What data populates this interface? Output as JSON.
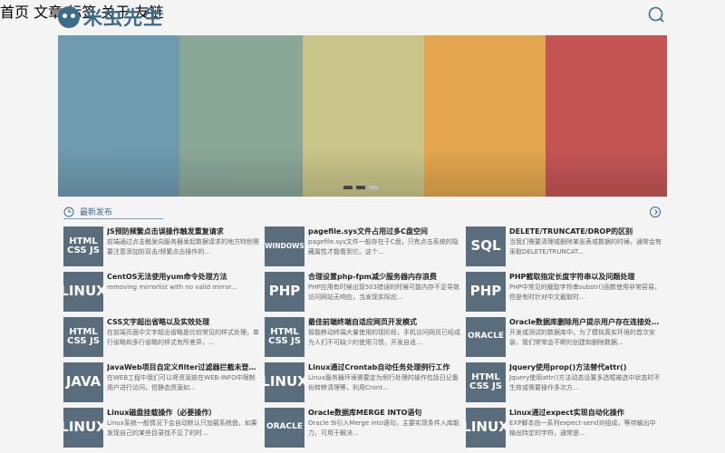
{
  "site": {
    "logo_text": "米虫先生"
  },
  "nav": [
    "首页",
    "文章",
    "标签",
    "关于",
    "友链"
  ],
  "banner": {
    "colors": [
      "#6f9bb0",
      "#8aa798",
      "#c9c58a",
      "#e3a64e",
      "#c45454"
    ],
    "active_dot": 2
  },
  "section": {
    "title": "最新发布"
  },
  "posts": [
    {
      "thumb": [
        "HTML",
        "CSS JS"
      ],
      "title": "JS预防频繁点击误操作触发重复请求",
      "desc": "前端通过点击触发向服务器发起数据请求的地方特别需要注意添加防双击/频繁点击操作的..."
    },
    {
      "thumb": [
        "WINDOWS"
      ],
      "title": "pagefile.sys文件占用过多C盘空间",
      "desc": "pagefile.sys文件一般存在于C盘，只有点击系统的隐藏属性才能看到它。这个..."
    },
    {
      "thumb": [
        "SQL"
      ],
      "title": "DELETE/TRUNCATE/DROP的区别",
      "desc": "当我们需要清理或删除某张表或数据的时候，通常会有采取DELETE/TRUNCAT..."
    },
    {
      "thumb": [
        "LINUX"
      ],
      "title": "CentOS无法使用yum命令处理方法",
      "desc": "removing mirrorlist with no valid mirror..."
    },
    {
      "thumb": [
        "PHP"
      ],
      "title": "合理设置php-fpm减少服务器内存浪费",
      "desc": "PHP应用有时候出现503错误的时候可能内存不足导致访问网站无响应，当发现实际应..."
    },
    {
      "thumb": [
        "PHP"
      ],
      "title": "PHP截取指定长度字符串以及问题处理",
      "desc": "PHP中常见的截取字符串substr()函数使用非常容易，但是有时针对中文截取时..."
    },
    {
      "thumb": [
        "HTML",
        "CSS JS"
      ],
      "title": "CSS文字超出省略以及实效处理",
      "desc": "在前端页面中文字超出省略是比较常见的样式处理，单行省略和多行省略的样式有所差异，..."
    },
    {
      "thumb": [
        "HTML",
        "CSS JS"
      ],
      "title": "最佳前端终端自适应网页开发模式",
      "desc": "智能移动终端大量使用的现阶段，手机访问网页已经成为人们不可缺少的使用习惯，开发自适..."
    },
    {
      "thumb": [
        "ORACLE"
      ],
      "title": "Oracle数据库删除用户提示用户存在连接处理...",
      "desc": "开发或测试的数据库中，为了模拟真实环境的首次安装，我们常常会不断的创建和删除数据..."
    },
    {
      "thumb": [
        "JAVA"
      ],
      "title": "JavaWeb项目自定义filter过滤器拦截未登录...",
      "desc": "在WEB工程中我们可以将资源放在WEB-INFO中限制用户进行访问，但静态资源如..."
    },
    {
      "thumb": [
        "LINUX"
      ],
      "title": "Linux通过Crontab自动任务处理例行工作",
      "desc": "Linux服务器环境需要定为例行处理的操作包括日记备份转移清理等，利用Cront..."
    },
    {
      "thumb": [
        "HTML",
        "CSS JS"
      ],
      "title": "Jquery使用prop()方法替代attr()",
      "desc": "Jquery使用attr()方法动态设置多选框被选中状态时不生效或需要操作多次方..."
    },
    {
      "thumb": [
        "LINUX"
      ],
      "title": "Linux磁盘挂载操作（必要操作）",
      "desc": "Linux系统一般情况下会自动默认只加载系统盘，如果发现自己的某些目录找不见了的时..."
    },
    {
      "thumb": [
        "ORACLE"
      ],
      "title": "Oracle数据库MERGE INTO语句",
      "desc": "Oracle 9i引入Merge into语句，主要实现条件入库能力，可用于解决..."
    },
    {
      "thumb": [
        "LINUX"
      ],
      "title": "Linux通过expect实现自动化操作",
      "desc": "EXP脚本由一系列expect-send对组成，等待输出中输出特定的字符，通常是..."
    }
  ]
}
